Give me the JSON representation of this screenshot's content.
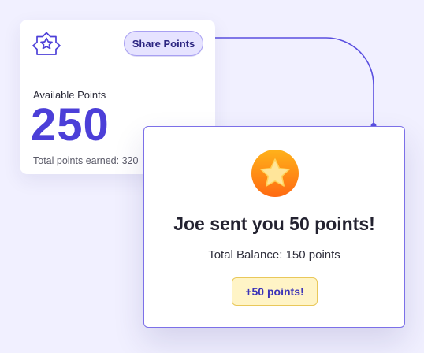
{
  "points_card": {
    "share_label": "Share Points",
    "available_label": "Available Points",
    "available_value": "250",
    "total_earned": "Total points earned: 320"
  },
  "notification": {
    "title": "Joe sent you 50 points!",
    "balance": "Total Balance: 150 points",
    "bonus": "+50 points!"
  },
  "icons": {
    "logo": "award-badge-icon",
    "star": "star-icon"
  },
  "colors": {
    "background": "#f1f0ff",
    "accent": "#4c3fd8",
    "connector": "#5a4fe0",
    "star_top": "#ffb21a",
    "star_bottom": "#ff6a12",
    "pill_bg": "#fff4c6"
  }
}
